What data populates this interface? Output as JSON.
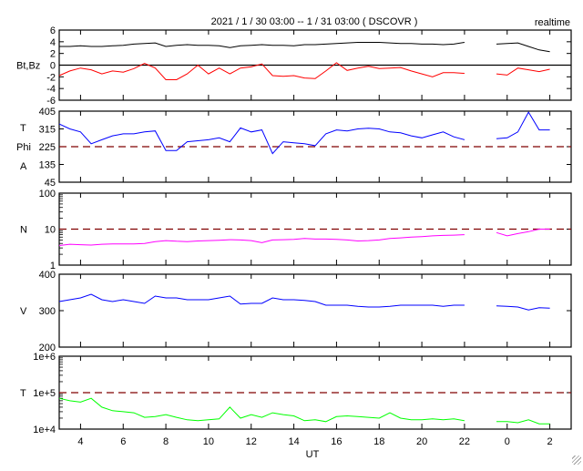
{
  "header": {
    "title": "2021 / 1 / 30   03:00 --  1 / 31   03:00 ( DSCOVR )",
    "mode": "realtime"
  },
  "chart_data": {
    "type": "line",
    "title": "2021 / 1 / 30   03:00 --  1 / 31   03:00 ( DSCOVR )",
    "xlabel": "UT",
    "xlim": [
      3,
      27
    ],
    "x_ticks": [
      4,
      6,
      8,
      10,
      12,
      14,
      16,
      18,
      20,
      22,
      24,
      26
    ],
    "x_tick_labels": [
      "4",
      "6",
      "8",
      "10",
      "12",
      "14",
      "16",
      "18",
      "20",
      "22",
      "0",
      "2"
    ],
    "x": [
      3,
      3.5,
      4,
      4.5,
      5,
      5.5,
      6,
      6.5,
      7,
      7.5,
      8,
      8.5,
      9,
      9.5,
      10,
      10.5,
      11,
      11.5,
      12,
      12.5,
      13,
      13.5,
      14,
      14.5,
      15,
      15.5,
      16,
      16.5,
      17,
      17.5,
      18,
      18.5,
      19,
      19.5,
      20,
      20.5,
      21,
      21.5,
      22,
      22.5,
      23,
      23.5,
      24,
      24.5,
      25,
      25.5,
      26
    ],
    "panels": [
      {
        "labels": [
          "Bt,Bz"
        ],
        "scale": "linear",
        "ylim": [
          -6,
          6
        ],
        "y_ticks": [
          6,
          4,
          2,
          0,
          -2,
          -4,
          -6
        ],
        "y_tick_labels": [
          "6",
          "4",
          "2",
          "0",
          "-2",
          "-4",
          "-6"
        ],
        "reference": {
          "value": 0,
          "style": "solid",
          "color": "#000000"
        },
        "series": [
          {
            "name": "Bt",
            "color": "#000000",
            "values": [
              3.2,
              3.2,
              3.3,
              3.2,
              3.2,
              3.3,
              3.4,
              3.6,
              3.7,
              3.8,
              3.2,
              3.4,
              3.5,
              3.4,
              3.4,
              3.3,
              3.0,
              3.3,
              3.4,
              3.5,
              3.4,
              3.4,
              3.3,
              3.5,
              3.5,
              3.6,
              3.7,
              3.8,
              3.9,
              3.9,
              3.9,
              3.8,
              3.7,
              3.7,
              3.6,
              3.6,
              3.5,
              3.6,
              3.9,
              null,
              null,
              3.6,
              3.7,
              3.8,
              3.2,
              2.6,
              2.3
            ]
          },
          {
            "name": "Bz",
            "color": "#ff0000",
            "values": [
              -1.8,
              -1.0,
              -0.5,
              -0.8,
              -1.5,
              -1.0,
              -1.2,
              -0.6,
              0.3,
              -0.5,
              -2.5,
              -2.5,
              -1.5,
              0.0,
              -1.5,
              -0.5,
              -1.5,
              -0.5,
              -0.3,
              0.2,
              -1.8,
              -1.9,
              -1.8,
              -2.2,
              -2.3,
              -1.0,
              0.4,
              -0.9,
              -0.5,
              -0.2,
              -0.6,
              -0.5,
              -0.4,
              -1.0,
              -1.5,
              -2.0,
              -1.3,
              -1.3,
              -1.4,
              null,
              null,
              -1.5,
              -1.7,
              -0.5,
              -0.8,
              -1.1,
              -0.7
            ]
          }
        ]
      },
      {
        "labels": [
          "T",
          "Phi",
          "A"
        ],
        "scale": "linear",
        "ylim": [
          45,
          405
        ],
        "y_ticks": [
          405,
          315,
          225,
          135,
          45
        ],
        "y_tick_labels": [
          "405",
          "315",
          "225",
          "135",
          "45"
        ],
        "reference": {
          "value": 225,
          "style": "dashed",
          "color": "#800000"
        },
        "series": [
          {
            "name": "Phi",
            "color": "#0000ff",
            "values": [
              340,
              315,
              300,
              240,
              260,
              280,
              290,
              290,
              300,
              305,
              205,
              205,
              250,
              255,
              260,
              270,
              250,
              320,
              300,
              310,
              190,
              250,
              245,
              240,
              230,
              290,
              310,
              305,
              315,
              318,
              315,
              300,
              295,
              280,
              270,
              285,
              300,
              275,
              260,
              null,
              null,
              265,
              270,
              300,
              400,
              310,
              310
            ]
          }
        ]
      },
      {
        "labels": [
          "N"
        ],
        "scale": "log",
        "ylim": [
          1,
          100
        ],
        "y_ticks": [
          100,
          10,
          1
        ],
        "y_tick_labels": [
          "100",
          "10",
          "1"
        ],
        "reference": {
          "value": 10,
          "style": "dashed",
          "color": "#800000"
        },
        "series": [
          {
            "name": "N",
            "color": "#ff00ff",
            "values": [
              3.5,
              3.8,
              3.7,
              3.6,
              3.8,
              3.9,
              3.9,
              3.9,
              4.0,
              4.5,
              4.8,
              4.6,
              4.5,
              4.7,
              4.8,
              4.9,
              5.1,
              5.0,
              4.8,
              4.2,
              5.0,
              5.1,
              5.2,
              5.5,
              5.3,
              5.3,
              5.2,
              5.0,
              4.7,
              4.8,
              5.0,
              5.5,
              5.7,
              6.0,
              6.2,
              6.5,
              6.7,
              6.8,
              7.0,
              null,
              null,
              8.0,
              6.5,
              7.5,
              8.5,
              10,
              10
            ]
          }
        ]
      },
      {
        "labels": [
          "V"
        ],
        "scale": "linear",
        "ylim": [
          200,
          400
        ],
        "y_ticks": [
          400,
          300,
          200
        ],
        "y_tick_labels": [
          "400",
          "300",
          "200"
        ],
        "reference": null,
        "series": [
          {
            "name": "V",
            "color": "#0000ff",
            "values": [
              325,
              330,
              335,
              345,
              330,
              325,
              330,
              325,
              320,
              340,
              335,
              335,
              330,
              330,
              330,
              335,
              340,
              318,
              320,
              320,
              335,
              330,
              330,
              328,
              325,
              315,
              315,
              315,
              312,
              310,
              310,
              312,
              315,
              315,
              315,
              315,
              312,
              315,
              315,
              null,
              null,
              313,
              312,
              310,
              302,
              308,
              307
            ]
          }
        ]
      },
      {
        "labels": [
          "T"
        ],
        "scale": "log",
        "ylim": [
          10000,
          1000000
        ],
        "y_ticks": [
          1000000,
          100000,
          10000
        ],
        "y_tick_labels": [
          "1e+6",
          "1e+5",
          "1e+4"
        ],
        "reference": {
          "value": 100000,
          "style": "dashed",
          "color": "#800000"
        },
        "series": [
          {
            "name": "Temperature",
            "color": "#00ff00",
            "values": [
              70000,
              60000,
              55000,
              70000,
              40000,
              32000,
              30000,
              28000,
              21000,
              22000,
              25000,
              21000,
              18000,
              17000,
              18000,
              19000,
              40000,
              20000,
              25000,
              21000,
              28000,
              25000,
              23000,
              17000,
              18000,
              16000,
              22000,
              23000,
              22000,
              21000,
              20000,
              28000,
              20000,
              18000,
              18000,
              19000,
              18000,
              19000,
              17000,
              null,
              null,
              16000,
              16000,
              15000,
              18000,
              14000,
              14000
            ]
          }
        ]
      }
    ]
  }
}
